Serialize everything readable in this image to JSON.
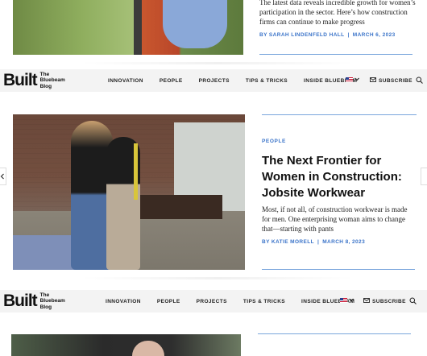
{
  "top_article": {
    "excerpt": "The latest data reveals incredible growth for women’s participation in the sector. Here’s how construction firms can continue to make progress",
    "author": "BY SARAH LINDENFELD HALL",
    "separator": "|",
    "date": "MARCH 6, 2023"
  },
  "navbar": {
    "logo_word": "Built",
    "logo_sub_1": "The",
    "logo_sub_2": "Bluebeam",
    "logo_sub_3": "Blog",
    "links": [
      "INNOVATION",
      "PEOPLE",
      "PROJECTS",
      "TIPS & TRICKS",
      "INSIDE BLUEBEAM"
    ],
    "language_icon": "us-flag-icon",
    "subscribe_label": "SUBSCRIBE",
    "search_icon": "search-icon"
  },
  "main_article": {
    "category": "PEOPLE",
    "title": "The Next Frontier for Women in Construction: Jobsite Workwear",
    "excerpt": "Most, if not all, of construction workwear is made for men. One enterprising woman aims to change that—starting with pants",
    "author": "BY KATIE MORELL",
    "separator": "|",
    "date": "MARCH 8, 2023"
  },
  "colors": {
    "accent": "#3b74c9",
    "rule": "#7aa6dc",
    "navbar_bg": "#f3f3f3"
  }
}
